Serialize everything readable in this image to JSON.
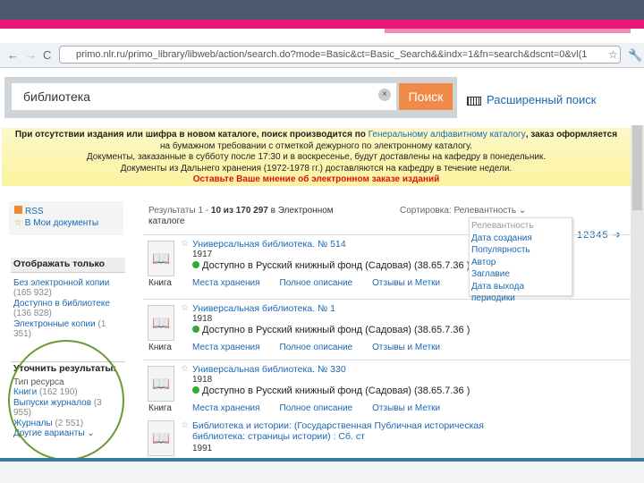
{
  "browser": {
    "url": "primo.nlr.ru/primo_library/libweb/action/search.do?mode=Basic&ct=Basic_Search&&indx=1&fn=search&dscnt=0&vl(1"
  },
  "search": {
    "query": "библиотека",
    "button": "Поиск",
    "advanced": "Расширенный поиск"
  },
  "notice": {
    "line1a": "При отсутствии издания или шифра в новом каталоге, поиск производится по ",
    "line1link": "Генеральному алфавитному каталогу",
    "line1b": ", заказ оформляется",
    "line2": "на бумажном требовании с отметкой дежурного по электронному каталогу.",
    "line3": "Документы, заказанные в субботу после 17:30 и в воскресенье, будут доставлены на кафедру в понедельник.",
    "line4": "Документы из Дальнего хранения (1972-1978 гг.) доставляются на кафедру в течение недели.",
    "line5": "Оставьте Ваше мнение об электронном заказе изданий"
  },
  "sidebar": {
    "rss": "RSS",
    "mydocs": "В Мои документы",
    "show_only": {
      "title": "Отображать только",
      "items": [
        {
          "label": "Без электронной копии",
          "count": "(165 932)"
        },
        {
          "label": "Доступно в библиотеке",
          "count": "(136 828)"
        },
        {
          "label": "Электронные копии",
          "count": "(1 351)"
        }
      ]
    },
    "refine": {
      "title": "Уточнить результаты:",
      "subtitle": "Тип ресурса",
      "items": [
        {
          "label": "Книги",
          "count": "(162 190)"
        },
        {
          "label": "Выпуски журналов",
          "count": "(3 955)"
        },
        {
          "label": "Журналы",
          "count": "(2 551)"
        }
      ],
      "more": "Другие варианты"
    }
  },
  "results": {
    "summary_a": "Результаты 1 - ",
    "summary_range": "10 из 170 297",
    "summary_b": " в Электронном каталоге",
    "sort_label": "Сортировка:",
    "sort_value": "Релевантность",
    "sort_options": [
      "Релевантность",
      "Дата создания",
      "Популярность",
      "Автор",
      "Заглавие",
      "Дата выхода периодики"
    ],
    "pages": [
      "1",
      "2",
      "3",
      "4",
      "5"
    ],
    "items": [
      {
        "title": "Универсальная библиотека. № 514",
        "year": "1917",
        "avail": "Доступно в Русский книжный фонд (Садовая)  (38.65.7.36 )",
        "type": "Книга"
      },
      {
        "title": "Универсальная библиотека. № 1",
        "year": "1918",
        "avail": "Доступно в Русский книжный фонд (Садовая)  (38.65.7.36 )",
        "type": "Книга"
      },
      {
        "title": "Универсальная библиотека. № 330",
        "year": "1918",
        "avail": "Доступно в Русский книжный фонд (Садовая)  (38.65.7.36 )",
        "type": "Книга"
      },
      {
        "title": "Библиотека и истории: (Государственная Публичная историческая библиотека: страницы истории) : Сб. ст",
        "year": "1991",
        "avail": "",
        "type": ""
      }
    ],
    "actions": [
      "Места хранения",
      "Полное описание",
      "Отзывы и Метки"
    ]
  },
  "colors": {
    "accent": "#e8197a",
    "header": "#4b5a6e",
    "search_button": "#f08a48",
    "link": "#1a68b2",
    "circle": "#6a9a32"
  }
}
